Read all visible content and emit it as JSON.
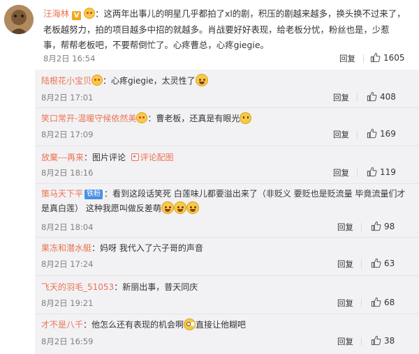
{
  "main_comment": {
    "username": "汪海林",
    "verified_badge": "V",
    "text": "：这两年出事儿的明星几乎都拍了xl的剧，积压的剧越来越多，换头换不过来了，老板越努力，拍的项目越多中招的就越多。肖战要好好表现，给老板分忧，粉丝也是，少惹事，帮帮老板吧，不要帮倒忙了。心疼曹总，心疼giegie。",
    "time": "8月2日 16:54",
    "reply_label": "回复",
    "likes": "1605"
  },
  "replies": [
    {
      "username": "陆根花小宝贝",
      "text": "：心疼giegie，太灵性了",
      "time": "8月2日 17:01",
      "reply_label": "回复",
      "likes": "408"
    },
    {
      "username": "笑口常开-温暖守候依然美",
      "text": "：曹老板，还真是有眼光",
      "time": "8月2日 17:09",
      "reply_label": "回复",
      "likes": "169"
    },
    {
      "username": "放棄---再来",
      "text": "：图片评论",
      "img_link": "评论配图",
      "time": "8月2日 18:16",
      "reply_label": "回复",
      "likes": "119"
    },
    {
      "username": "策马天下平",
      "badge": "铁粉",
      "text": "：看到这段话笑死 白莲味儿都要溢出来了（非贬义 要贬也是贬流量 毕竟流量们才是真白莲） 这种我愿叫做反差萌",
      "time": "8月2日 18:04",
      "reply_label": "回复",
      "likes": "98"
    },
    {
      "username": "果冻和潜水艇",
      "text": "：妈呀 我代入了六子哥的声音",
      "time": "8月2日 17:24",
      "reply_label": "回复",
      "likes": "63"
    },
    {
      "username": "飞天的羽毛_51053",
      "text": "：新丽出事，普天同庆",
      "time": "8月2日 19:21",
      "reply_label": "回复",
      "likes": "68"
    },
    {
      "username": "才不是八千",
      "text": "：他怎么还有表现的机会啊",
      "text_after": "直接让他糊吧",
      "time": "8月2日 16:59",
      "reply_label": "回复",
      "likes": "38"
    }
  ],
  "colors": {
    "username": "#eb7350",
    "meta": "#808080",
    "reply_bg": "#f2f2f5",
    "text": "#333333"
  },
  "icons": [
    "avatar-image",
    "verified-badge",
    "heart-eyes-emoji",
    "thumbs-up-icon",
    "grin-sweat-emoji",
    "thinking-emoji",
    "picture-icon",
    "eye-roll-emoji"
  ]
}
